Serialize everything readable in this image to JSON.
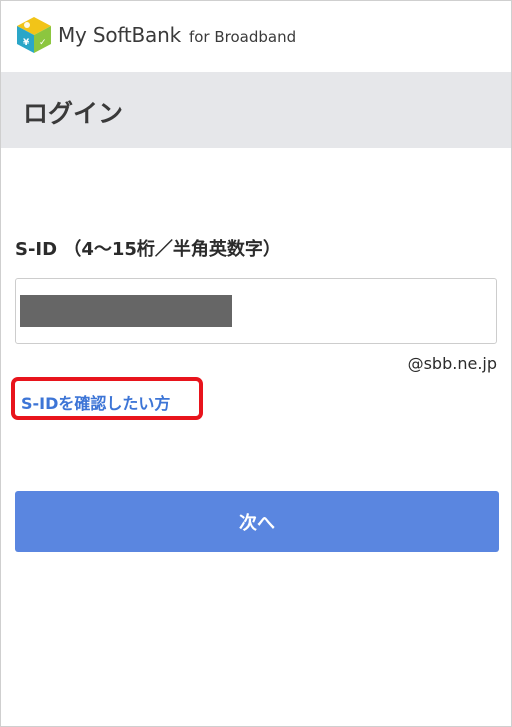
{
  "header": {
    "brand_name": "My SoftBank",
    "brand_sub": "for Broadband",
    "logo_icon": "softbank-cube-logo-icon"
  },
  "title_bar": {
    "title": "ログイン"
  },
  "form": {
    "sid_label": "S-ID （4〜15桁／半角英数字）",
    "sid_value_masked": true,
    "domain_suffix": "@sbb.ne.jp",
    "confirm_sid_link": "S-IDを確認したい方",
    "next_button": "次へ"
  },
  "colors": {
    "title_bar_bg": "#e6e7ea",
    "link": "#3d75d6",
    "highlight": "#e8141c",
    "button_bg": "#5a86e0",
    "mask": "#666666"
  }
}
